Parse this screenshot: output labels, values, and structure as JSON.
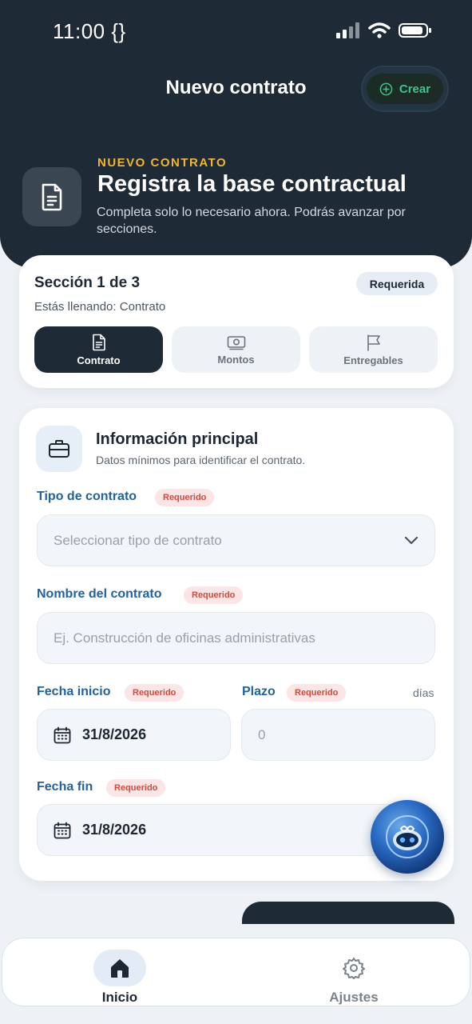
{
  "status_bar": {
    "time": "11:00 {}"
  },
  "header": {
    "title": "Nuevo contrato",
    "create_label": "Crear",
    "kicker": "NUEVO CONTRATO",
    "hero_title": "Registra la base contractual",
    "hero_subtitle": "Completa solo lo necesario ahora. Podrás avanzar por secciones."
  },
  "section_card": {
    "title": "Sección 1 de 3",
    "subtitle": "Estás llenando: Contrato",
    "badge": "Requerida",
    "tabs": [
      {
        "label": "Contrato",
        "icon": "document-icon",
        "active": true
      },
      {
        "label": "Montos",
        "icon": "money-icon",
        "active": false
      },
      {
        "label": "Entregables",
        "icon": "flag-icon",
        "active": false
      }
    ]
  },
  "info_card": {
    "title": "Información principal",
    "subtitle": "Datos mínimos para identificar el contrato.",
    "required_label": "Requerido",
    "tipo": {
      "label": "Tipo de contrato",
      "placeholder": "Seleccionar tipo de contrato"
    },
    "nombre": {
      "label": "Nombre del contrato",
      "placeholder": "Ej. Construcción de oficinas administrativas"
    },
    "fecha_inicio": {
      "label": "Fecha inicio",
      "value": "31/8/2026"
    },
    "plazo": {
      "label": "Plazo",
      "unit": "días",
      "placeholder": "0"
    },
    "fecha_fin": {
      "label": "Fecha fin",
      "value": "31/8/2026"
    }
  },
  "tab_bar": {
    "items": [
      {
        "label": "Inicio",
        "icon": "home-icon",
        "active": true
      },
      {
        "label": "Ajustes",
        "icon": "gear-icon",
        "active": false
      }
    ]
  },
  "colors": {
    "dark": "#1e2a36",
    "accent_yellow": "#f2b631",
    "label_blue": "#23629b",
    "green": "#3ec48a",
    "required_red": "#d24a3e"
  }
}
